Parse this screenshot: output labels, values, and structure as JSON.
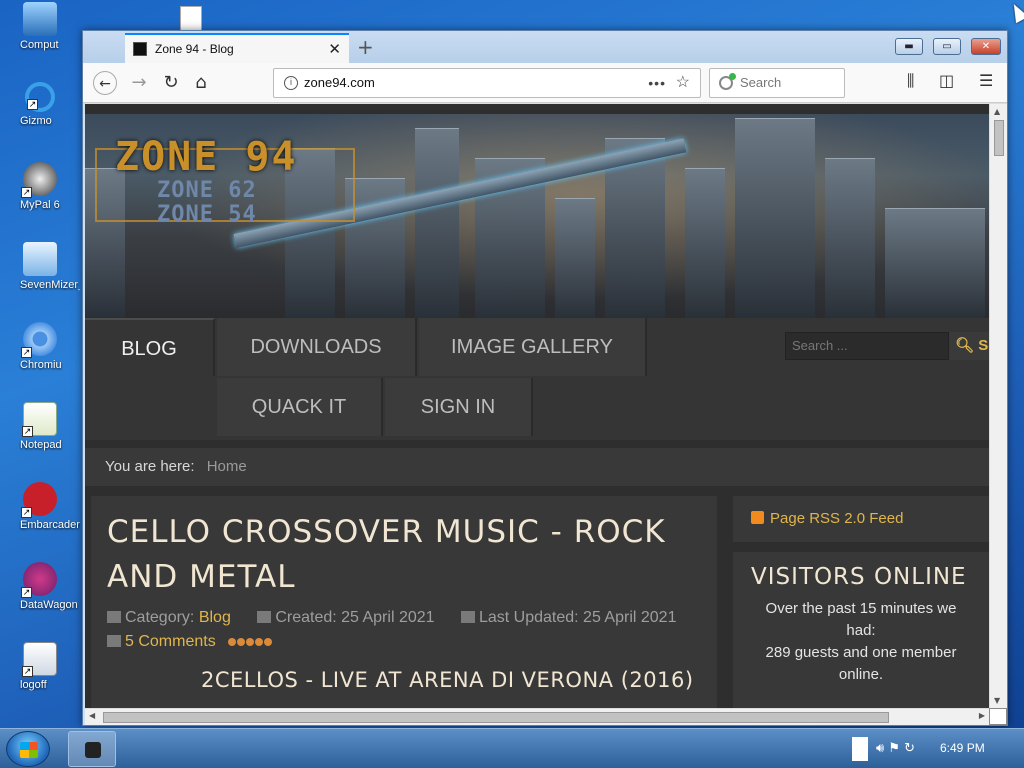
{
  "desktop": {
    "icons": [
      {
        "label": "Comput"
      },
      {
        "label": "Gizmo"
      },
      {
        "label": "MyPal 6"
      },
      {
        "label": "SevenMizer_"
      },
      {
        "label": "Chromiu"
      },
      {
        "label": "Notepad"
      },
      {
        "label": "Embarcadero D"
      },
      {
        "label": "DataWagon"
      },
      {
        "label": "logoff"
      }
    ]
  },
  "browser": {
    "tab_title": "Zone 94 - Blog",
    "url": "zone94.com",
    "search_placeholder": "Search"
  },
  "site": {
    "logo_main": "ZONE 94",
    "logo_sub1": "ZONE 62",
    "logo_sub2": "ZONE 54",
    "menu": [
      "BLOG",
      "DOWNLOADS",
      "IMAGE GALLERY",
      "QUACK IT",
      "SIGN IN"
    ],
    "search_placeholder": "Search ...",
    "search_button": "Se",
    "breadcrumb_prefix": "You are here:",
    "breadcrumb_home": "Home",
    "article": {
      "title": "CELLO CROSSOVER MUSIC - ROCK AND METAL",
      "category_label": "Category:",
      "category": "Blog",
      "created": "Created: 25 April 2021",
      "updated": "Last Updated: 25 April 2021",
      "comments": "5 Comments",
      "subtitle": "2CELLOS - LIVE AT ARENA DI VERONA (2016)"
    },
    "sidebar": {
      "rss": "Page RSS 2.0 Feed",
      "visitors_title": "VISITORS ONLINE",
      "visitors_text1": "Over the past 15 minutes we had:",
      "visitors_text2": "289 guests and one member online."
    }
  },
  "taskbar": {
    "clock": "6:49 PM"
  }
}
